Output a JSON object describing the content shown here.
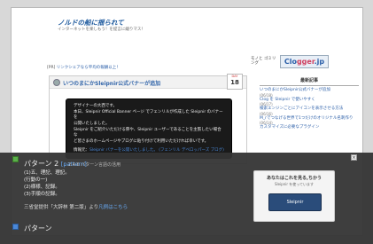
{
  "blog": {
    "title": "ノルドの船に揺られて",
    "subtitle": "インターネットを楽しもう！を提言に綴りマス！",
    "notice_tag": "[PR]",
    "notice_link": "リンクシェアなら平均の報酬以上！"
  },
  "banner": {
    "text": "モノと ゴミリング",
    "logo_main": "Clo",
    "logo_accent": "gger",
    "logo_end": ".jp"
  },
  "post": {
    "title": "いつのまにかSleipnir公式バナーが追加",
    "day_word": "DAY",
    "day_num": "18"
  },
  "tooltip": {
    "lines": [
      "デザイナーの大西です。",
      "本日、Sleipnir Official Banner ページ でフェンリルが作成した Sleipnir のバナーを",
      "公開いたしました。",
      "Sleipnir をご紹介いただける際や、Sleipnir ユーザーであることを主張したい場合な",
      "ど皆さまのホームページやブログに貼り付けて利用いただければ幸いです。"
    ],
    "label": "情報元：",
    "link": "Sleipnir バナーを公開いたしました。 (フェンリル デベロッパーズ ブログ)"
  },
  "sidebar": {
    "title": "最新記事",
    "items": [
      {
        "label": "いつのまにかSleipnir公式バナーが追加",
        "date": "(06/18)"
      },
      {
        "label": "Clog を Sleipnir で使いやすく",
        "date": "(06/17)"
      },
      {
        "label": "検索エンジンごとにアイコンを表示させる方法",
        "date": "(06/16)"
      },
      {
        "label": "M_rでつなげる世界で1つだけのオリジナル名刺作り",
        "date": "(06/14)"
      },
      {
        "label": "カスタマイズに必要なプラグイン",
        "date": ""
      }
    ]
  },
  "overlay": {
    "title": "パターン 2",
    "title_tag": "[pattern]",
    "desc": "2.4.6 パターン言語の活用",
    "lines": [
      "(1)五、理記、理記。",
      "(行動の一)",
      "(2)様様、記録。",
      "(3)手順の記録。"
    ],
    "source_prefix": "出典",
    "source_text": "三省堂提供「大辞林 第二版」より",
    "source_link": "凡例はこちら",
    "close": "×",
    "title2": "パターン"
  },
  "card": {
    "title": "あなたはこれを見る,ちかう",
    "subtitle": "Sleipnir を使っています",
    "button": "Sleipnir"
  }
}
